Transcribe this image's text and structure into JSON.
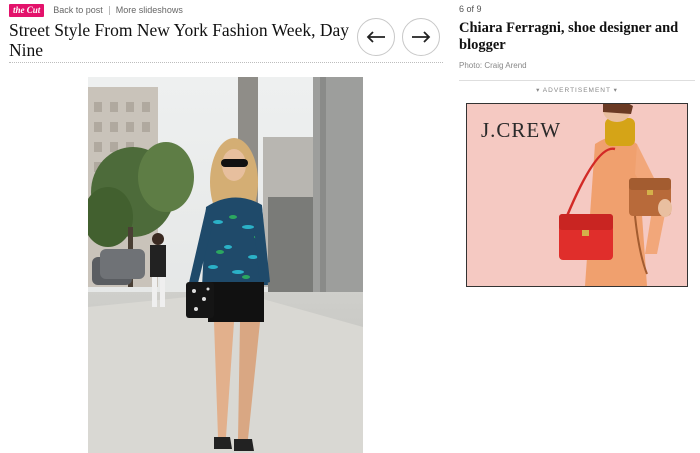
{
  "header": {
    "logo_text": "the Cut",
    "links": [
      "Back to post",
      "More slideshows"
    ],
    "title": "Street Style From New York Fashion Week, Day Nine"
  },
  "nav": {
    "prev_icon": "arrow-left-icon",
    "next_icon": "arrow-right-icon"
  },
  "slide": {
    "counter": "6 of 9",
    "caption": "Chiara Ferragni, shoe designer and blogger",
    "credit": "Photo: Craig Arend"
  },
  "ad": {
    "label": "▾ ADVERTISEMENT ▾",
    "brand": "J.CREW"
  },
  "colors": {
    "brand_pink": "#e3126b",
    "ad_background": "#f5c9c2",
    "bag_red": "#e02e2b"
  }
}
